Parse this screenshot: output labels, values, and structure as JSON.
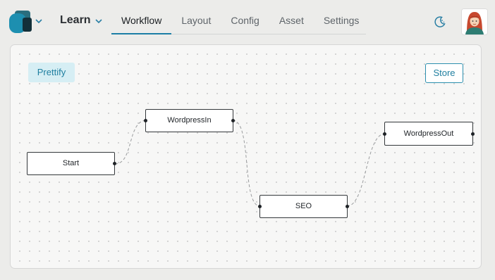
{
  "header": {
    "logo_icon": "app-logo-icon",
    "logo_menu_icon": "chevron-down-icon",
    "project_name": "Learn",
    "project_menu_icon": "chevron-down-icon",
    "theme_icon": "moon-icon",
    "avatar_icon": "user-avatar-icon",
    "accent_color": "#1c7fa6"
  },
  "tabs": [
    {
      "label": "Workflow",
      "active": true
    },
    {
      "label": "Layout",
      "active": false
    },
    {
      "label": "Config",
      "active": false
    },
    {
      "label": "Asset",
      "active": false
    },
    {
      "label": "Settings",
      "active": false
    }
  ],
  "canvas": {
    "prettify_label": "Prettify",
    "store_label": "Store"
  },
  "workflow": {
    "nodes": [
      {
        "id": "start",
        "label": "Start"
      },
      {
        "id": "wp_in",
        "label": "WordpressIn"
      },
      {
        "id": "seo",
        "label": "SEO"
      },
      {
        "id": "wp_out",
        "label": "WordpressOut"
      }
    ],
    "edges": [
      {
        "from": "start",
        "to": "wp_in"
      },
      {
        "from": "wp_in",
        "to": "seo"
      },
      {
        "from": "seo",
        "to": "wp_out"
      }
    ]
  }
}
